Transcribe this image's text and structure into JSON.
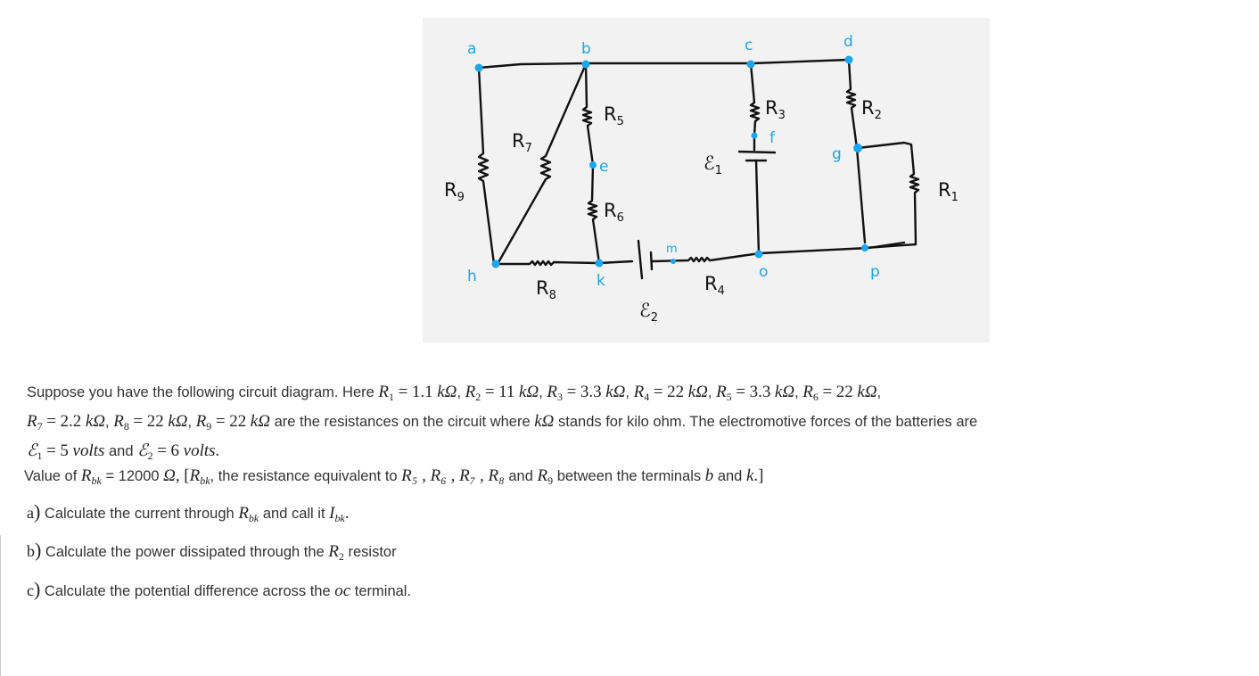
{
  "figure": {
    "nodes": [
      "a",
      "b",
      "c",
      "d",
      "e",
      "f",
      "g",
      "h",
      "k",
      "m",
      "o",
      "p"
    ],
    "components": {
      "R1": "R1",
      "R2": "R2",
      "R3": "R3",
      "R4": "R4",
      "R5": "R5",
      "R6": "R6",
      "R7": "R7",
      "R8": "R8",
      "R9": "R9",
      "E1": "E1",
      "E2": "E2"
    },
    "node_color": "#1aa6f0",
    "wire_color": "#111111",
    "background": "#f2f2f2"
  },
  "problem": {
    "intro": "Suppose you have the following circuit diagram. Here",
    "resistances": [
      {
        "name": "R",
        "sub": "1",
        "value": "1.1",
        "unit": "kΩ"
      },
      {
        "name": "R",
        "sub": "2",
        "value": "11",
        "unit": "kΩ"
      },
      {
        "name": "R",
        "sub": "3",
        "value": "3.3",
        "unit": "kΩ"
      },
      {
        "name": "R",
        "sub": "4",
        "value": "22",
        "unit": "kΩ"
      },
      {
        "name": "R",
        "sub": "5",
        "value": "3.3",
        "unit": "kΩ"
      },
      {
        "name": "R",
        "sub": "6",
        "value": "22",
        "unit": "kΩ"
      },
      {
        "name": "R",
        "sub": "7",
        "value": "2.2",
        "unit": "kΩ"
      },
      {
        "name": "R",
        "sub": "8",
        "value": "22",
        "unit": "kΩ"
      },
      {
        "name": "R",
        "sub": "9",
        "value": "22",
        "unit": "kΩ"
      }
    ],
    "mid_text_1": "are the resistances on the circuit where",
    "kohm": "kΩ",
    "mid_text_2": "stands for kilo ohm. The electromotive forces of the batteries are",
    "emf": [
      {
        "name": "ℰ",
        "sub": "1",
        "value": "5",
        "unit": "volts"
      },
      {
        "name": "ℰ",
        "sub": "2",
        "value": "6",
        "unit": "volts"
      }
    ],
    "and": "and",
    "rbk_line": {
      "prefix": "Value of",
      "symbol": "R",
      "sub": "bk",
      "equals": "=",
      "value": "12000",
      "unit": "Ω,",
      "bracket_open": "[",
      "text1": ", the resistance equivalent to",
      "list": "R₅ , R₆ , R₇ , R₈",
      "and": "and",
      "r9": "R",
      "r9sub": "9",
      "text2": "between the terminals",
      "t1": "b",
      "t_and": "and",
      "t2": "k",
      "bracket_close": ".]"
    },
    "questions": [
      {
        "label": "a",
        "text1": "Calculate the current through",
        "sym": "R",
        "sub": "bk",
        "text2": "and call it",
        "sym2": "I",
        "sub2": "bk",
        "end": "."
      },
      {
        "label": "b",
        "text1": "Calculate the power dissipated through the",
        "sym": "R",
        "sub": "2",
        "text2": "resistor"
      },
      {
        "label": "c",
        "text1": "Calculate the potential difference across the",
        "sym": "oc",
        "text2": "terminal."
      }
    ]
  }
}
